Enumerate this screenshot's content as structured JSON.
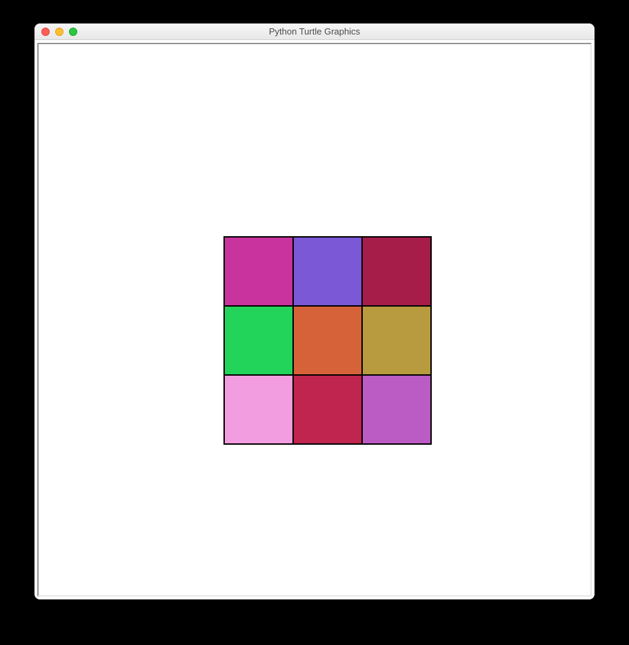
{
  "window": {
    "title": "Python Turtle Graphics"
  },
  "traffic_lights": {
    "close": "close",
    "minimize": "minimize",
    "zoom": "zoom"
  },
  "grid": {
    "rows": 3,
    "cols": 3,
    "cell_size": 100,
    "border_color": "#000000",
    "cells": [
      {
        "row": 0,
        "col": 0,
        "color": "#c9339e"
      },
      {
        "row": 0,
        "col": 1,
        "color": "#7a58d6"
      },
      {
        "row": 0,
        "col": 2,
        "color": "#a61d4a"
      },
      {
        "row": 1,
        "col": 0,
        "color": "#22d55a"
      },
      {
        "row": 1,
        "col": 1,
        "color": "#d6623a"
      },
      {
        "row": 1,
        "col": 2,
        "color": "#b89a3f"
      },
      {
        "row": 2,
        "col": 0,
        "color": "#f29de0"
      },
      {
        "row": 2,
        "col": 1,
        "color": "#c0254f"
      },
      {
        "row": 2,
        "col": 2,
        "color": "#bb5cc5"
      }
    ]
  }
}
